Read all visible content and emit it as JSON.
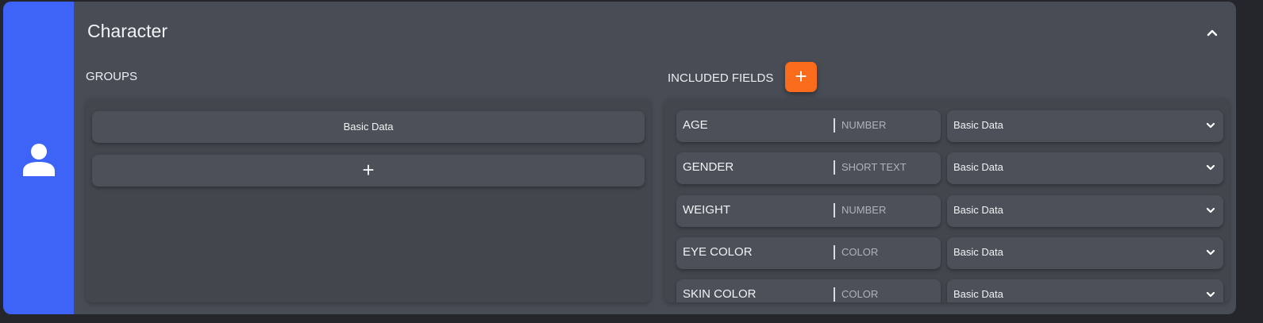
{
  "section": {
    "title": "Character",
    "icon": "user-icon",
    "accent": "#3d64f6"
  },
  "groups": {
    "label": "GROUPS",
    "items": [
      "Basic Data"
    ],
    "add_label": "+"
  },
  "fields": {
    "label": "INCLUDED FIELDS",
    "add_label": "+",
    "add_color": "#fb6b1c",
    "rows": [
      {
        "name": "AGE",
        "type": "NUMBER",
        "group": "Basic Data"
      },
      {
        "name": "GENDER",
        "type": "SHORT TEXT",
        "group": "Basic Data"
      },
      {
        "name": "WEIGHT",
        "type": "NUMBER",
        "group": "Basic Data"
      },
      {
        "name": "EYE COLOR",
        "type": "COLOR",
        "group": "Basic Data"
      },
      {
        "name": "SKIN COLOR",
        "type": "COLOR",
        "group": "Basic Data"
      }
    ]
  }
}
